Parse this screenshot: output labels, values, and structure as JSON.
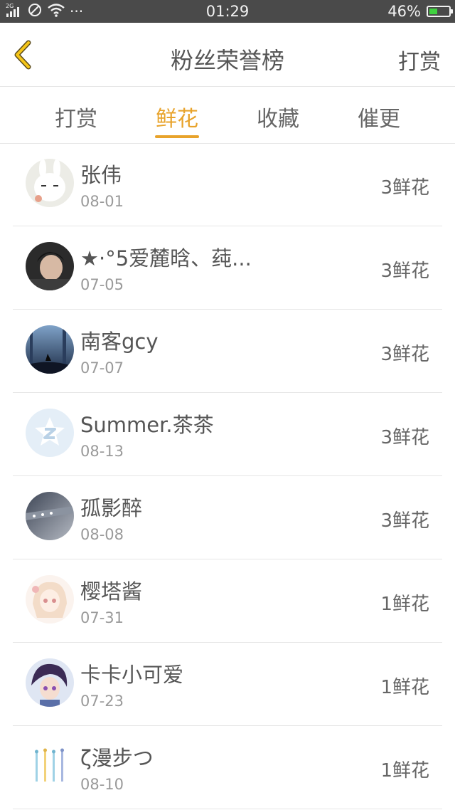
{
  "status_bar": {
    "network": "2G",
    "dots": "···",
    "time": "01:29",
    "battery_percent": "46%",
    "battery_level": 0.46
  },
  "header": {
    "title": "粉丝荣誉榜",
    "right_action": "打赏",
    "accent_color": "#e8a32b"
  },
  "tabs": [
    {
      "label": "打赏",
      "active": false
    },
    {
      "label": "鲜花",
      "active": true
    },
    {
      "label": "收藏",
      "active": false
    },
    {
      "label": "催更",
      "active": false
    }
  ],
  "list": [
    {
      "name": "张伟",
      "date": "08-01",
      "count": "3鲜花",
      "avatar": "white-rabbit-avatar"
    },
    {
      "name": "★·°5爱麓晗、莼...",
      "date": "07-05",
      "count": "3鲜花",
      "avatar": "boy-portrait-avatar"
    },
    {
      "name": "南客gcy",
      "date": "07-07",
      "count": "3鲜花",
      "avatar": "wolf-forest-avatar"
    },
    {
      "name": "Summer.茶茶",
      "date": "08-13",
      "count": "3鲜花",
      "avatar": "default-qq-avatar"
    },
    {
      "name": "孤影醉",
      "date": "08-08",
      "count": "3鲜花",
      "avatar": "tunnel-avatar"
    },
    {
      "name": "樱塔酱",
      "date": "07-31",
      "count": "1鲜花",
      "avatar": "anime-girl-avatar"
    },
    {
      "name": "卡卡小可爱",
      "date": "07-23",
      "count": "1鲜花",
      "avatar": "anime-boy-avatar"
    },
    {
      "name": "ζ漫步つ",
      "date": "08-10",
      "count": "1鲜花",
      "avatar": "umbrellas-avatar"
    }
  ]
}
